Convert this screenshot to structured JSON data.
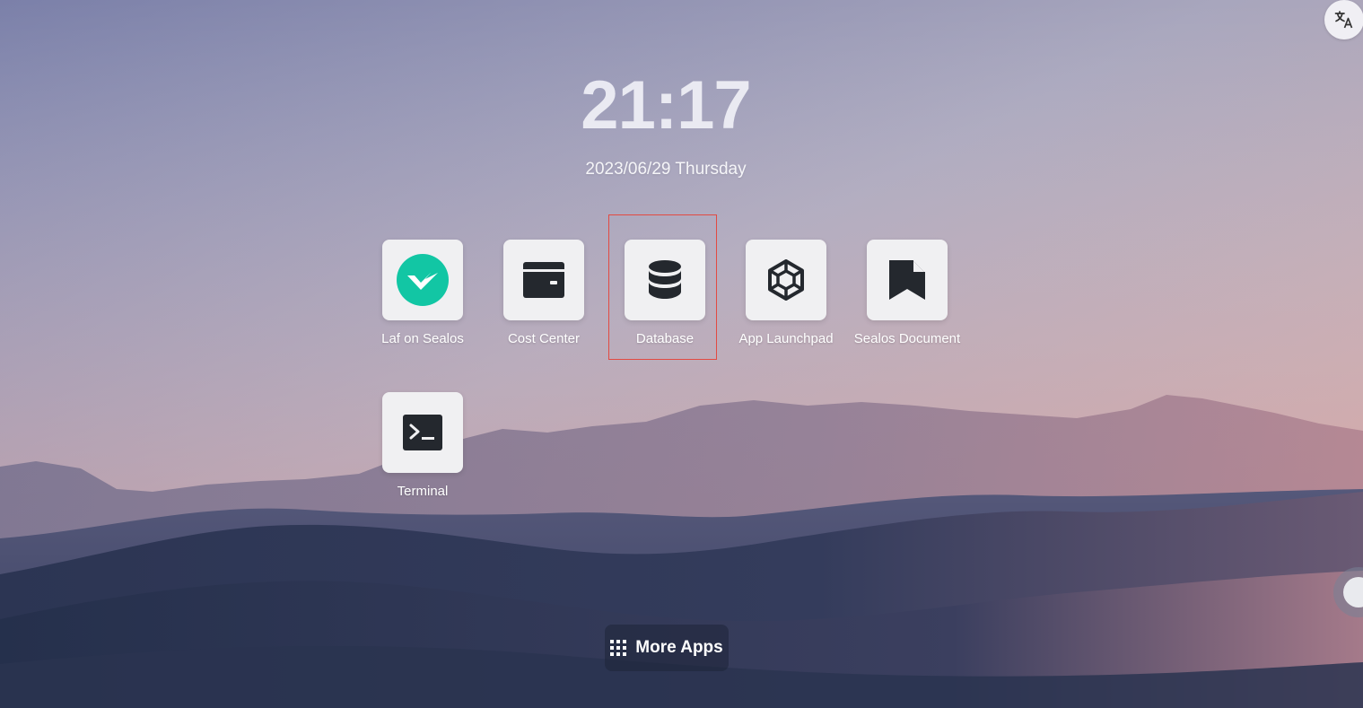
{
  "desktop": {
    "time": "21:17",
    "date": "2023/06/29 Thursday"
  },
  "apps": [
    {
      "label": "Laf on Sealos",
      "icon": "laf-logo-icon"
    },
    {
      "label": "Cost Center",
      "icon": "wallet-icon"
    },
    {
      "label": "Database",
      "icon": "database-icon"
    },
    {
      "label": "App Launchpad",
      "icon": "hexagon-cube-icon"
    },
    {
      "label": "Sealos Document",
      "icon": "bookmark-document-icon"
    },
    {
      "label": "Terminal",
      "icon": "terminal-icon"
    }
  ],
  "more_apps": {
    "label": "More Apps",
    "icon": "grid-icon"
  },
  "toolbar": {
    "language_icon": "translate-icon",
    "floating_icon": "floating-ball-icon"
  },
  "colors": {
    "tile_bg": "#f0f0f2",
    "laf_accent": "#12c6a4",
    "icon_dark": "#24282e",
    "highlight": "#e24a42"
  }
}
